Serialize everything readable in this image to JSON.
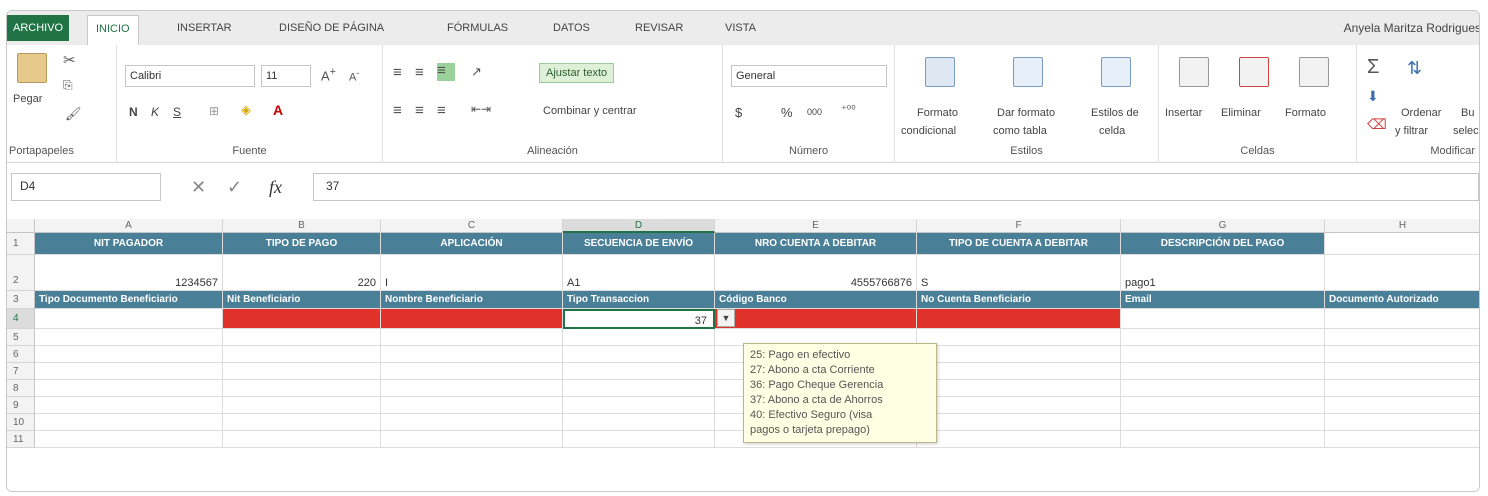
{
  "tabs": {
    "file": "ARCHIVO",
    "home": "INICIO",
    "insert": "INSERTAR",
    "page_layout": "DISEÑO DE PÁGINA",
    "formulas": "FÓRMULAS",
    "data": "DATOS",
    "review": "REVISAR",
    "view": "VISTA",
    "user": "Anyela Maritza Rodrigues"
  },
  "ribbon": {
    "clipboard": {
      "paste": "Pegar",
      "name": "Portapapeles"
    },
    "font": {
      "family": "Calibri",
      "size": "11",
      "bold": "N",
      "italic": "K",
      "underline": "S",
      "name": "Fuente"
    },
    "alignment": {
      "wrap": "Ajustar texto",
      "merge": "Combinar y centrar",
      "name": "Alineación"
    },
    "number": {
      "format": "General",
      "currency": "$",
      "percent": "%",
      "thousands": "000",
      "name": "Número"
    },
    "styles": {
      "cond1": "Formato",
      "cond2": "condicional",
      "table1": "Dar formato",
      "table2": "como tabla",
      "cell1": "Estilos de",
      "cell2": "celda",
      "name": "Estilos"
    },
    "cells": {
      "insert": "Insertar",
      "delete": "Eliminar",
      "format": "Formato",
      "name": "Celdas"
    },
    "editing": {
      "sort1": "Ordenar",
      "sort2": "y filtrar",
      "find1": "Bu",
      "find2": "selec",
      "name": "Modificar"
    }
  },
  "formula_bar": {
    "name_box": "D4",
    "fx": "fx",
    "value": "37"
  },
  "columns": [
    "A",
    "B",
    "C",
    "D",
    "E",
    "F",
    "G",
    "H"
  ],
  "rows": [
    "1",
    "2",
    "3",
    "4",
    "5",
    "6",
    "7",
    "8",
    "9",
    "10",
    "11"
  ],
  "row1": [
    "NIT PAGADOR",
    "TIPO DE PAGO",
    "APLICACIÓN",
    "SECUENCIA DE ENVÍO",
    "NRO CUENTA A DEBITAR",
    "TIPO DE CUENTA A DEBITAR",
    "DESCRIPCIÓN DEL PAGO"
  ],
  "row2": [
    "1234567",
    "220",
    "I",
    "A1",
    "4555766876",
    "S",
    "pago1"
  ],
  "row3": [
    "Tipo Documento Beneficiario",
    "Nit Beneficiario",
    "Nombre Beneficiario",
    "Tipo Transaccion",
    "Código Banco",
    "No Cuenta Beneficiario",
    "Email",
    "Documento Autorizado"
  ],
  "active_value": "37",
  "dropdown_options": [
    "25: Pago en efectivo",
    "27: Abono a cta Corriente",
    "36: Pago Cheque Gerencia",
    "37: Abono a cta de Ahorros",
    "40: Efectivo Seguro (visa",
    "pagos o tarjeta prepago)"
  ],
  "colors": {
    "header_blue": "#4a7f98",
    "error_red": "#e0322a",
    "excel_green": "#217346"
  }
}
